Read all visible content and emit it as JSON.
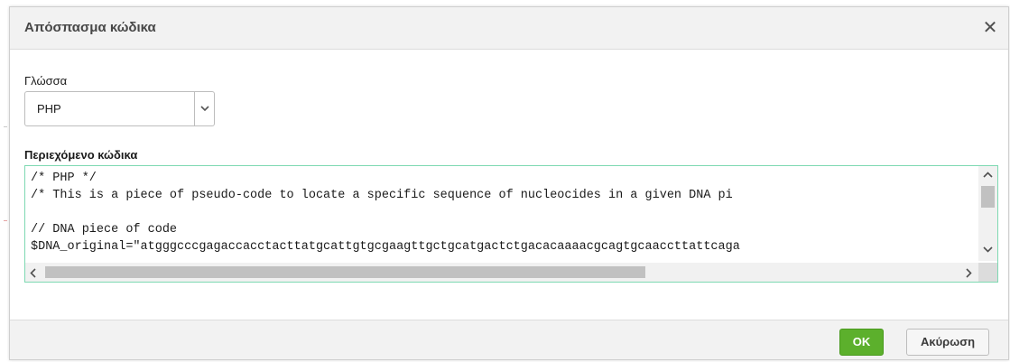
{
  "dialog": {
    "title": "Απόσπασμα κώδικα",
    "close_icon": "close-icon"
  },
  "language": {
    "label": "Γλώσσα",
    "selected": "PHP"
  },
  "code": {
    "label": "Περιεχόμενο κώδικα",
    "lines": [
      "/* PHP */",
      "/* This is a piece of pseudo-code to locate a specific sequence of nucleocides in a given DNA pi",
      "",
      "// DNA piece of code",
      "$DNA_original=\"atgggcccgagaccacctacttatgcattgtgcgaagttgctgcatgactctgacacaaaacgcagtgcaaccttattcaga"
    ]
  },
  "footer": {
    "ok_label": "OK",
    "cancel_label": "Ακύρωση"
  },
  "colors": {
    "accent_green": "#5cb02c",
    "code_border": "#7ed9b2",
    "header_bg": "#f2f2f2"
  }
}
